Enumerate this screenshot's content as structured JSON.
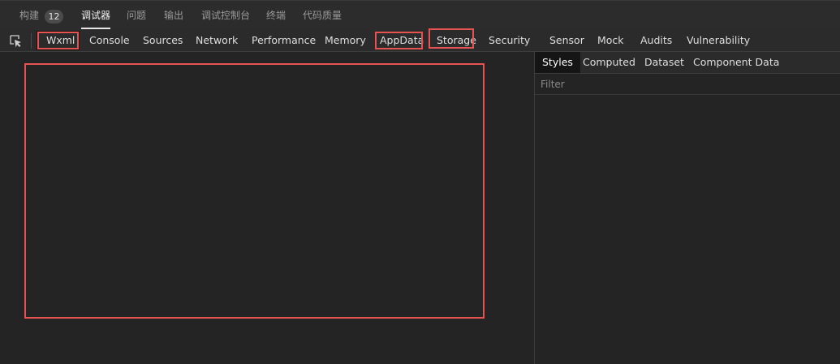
{
  "top_tabs": {
    "build": "构建",
    "build_count": "12",
    "debugger": "调试器",
    "issues": "问题",
    "output": "输出",
    "debug_console": "调试控制台",
    "terminal": "终端",
    "code_quality": "代码质量"
  },
  "devtools_tabs": {
    "wxml": "Wxml",
    "console": "Console",
    "sources": "Sources",
    "network": "Network",
    "performance": "Performance",
    "memory": "Memory",
    "appdata": "AppData",
    "storage": "Storage",
    "security": "Security",
    "sensor": "Sensor",
    "mock": "Mock",
    "audits": "Audits",
    "vulnerability": "Vulnerability"
  },
  "inspect_icon": "element-picker-icon",
  "right_panel": {
    "tabs": {
      "styles": "Styles",
      "computed": "Computed",
      "dataset": "Dataset",
      "component_data": "Component Data"
    },
    "filter_placeholder": "Filter"
  },
  "colors": {
    "highlight": "#e65353",
    "background": "#242424"
  }
}
